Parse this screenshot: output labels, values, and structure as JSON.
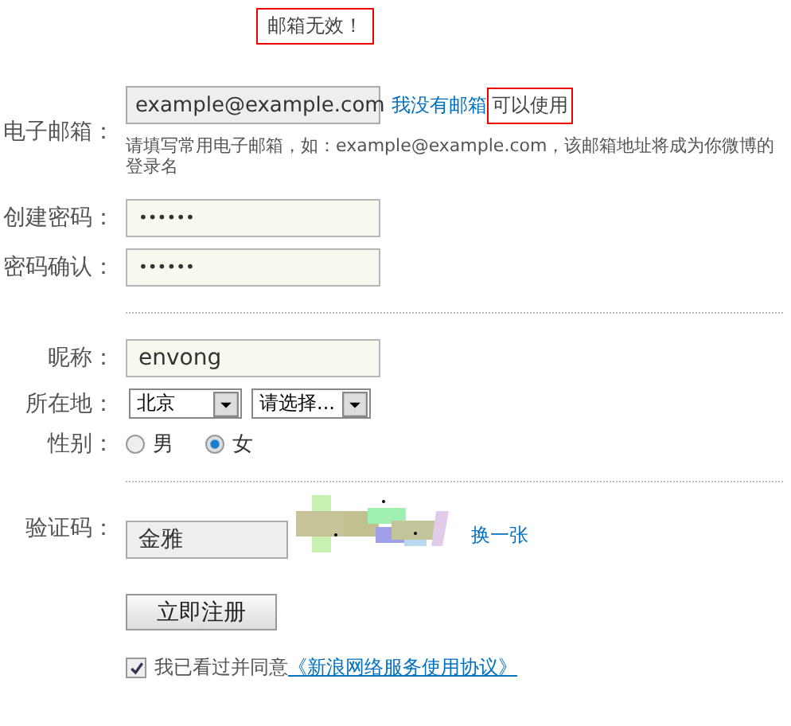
{
  "error_message": "邮箱无效！",
  "email": {
    "label": "电子邮箱：",
    "value": "example@example.com",
    "link": "我没有邮箱",
    "status": "可以使用",
    "hint": "请填写常用电子邮箱，如：example@example.com，该邮箱地址将成为你微博的登录名"
  },
  "passwords": [
    {
      "label": "创建密码：",
      "value": "••••••"
    },
    {
      "label": "密码确认：",
      "value": "••••••"
    }
  ],
  "nickname": {
    "label": "昵称：",
    "value": "envong"
  },
  "location": {
    "label": "所在地：",
    "selects": [
      "北京",
      "请选择..."
    ]
  },
  "gender": {
    "label": "性别：",
    "options": [
      {
        "label": "男",
        "selected": false
      },
      {
        "label": "女",
        "selected": true
      }
    ]
  },
  "captcha": {
    "label": "验证码：",
    "value": "金雅",
    "refresh_link": "换一张"
  },
  "submit": "立即注册",
  "agreement": {
    "checked": true,
    "text": "我已看过并同意",
    "link": "《新浪网络服务使用协议》"
  }
}
